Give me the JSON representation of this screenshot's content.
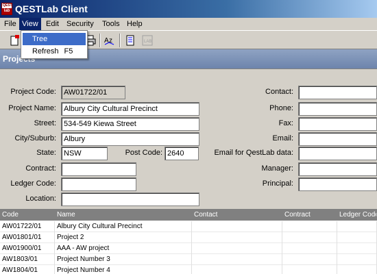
{
  "app": {
    "title": "QESTLab Client",
    "logo_top": "QEST",
    "logo_bottom": "lab"
  },
  "menu": {
    "file": "File",
    "view": "View",
    "edit": "Edit",
    "security": "Security",
    "tools": "Tools",
    "help": "Help"
  },
  "view_menu": {
    "tree": "Tree",
    "refresh": "Refresh",
    "refresh_shortcut": "F5"
  },
  "toolbar": {
    "icons": [
      "new-icon",
      "print-icon",
      "spell-check-icon",
      "copy-list-icon",
      "qestlab-disabled-icon"
    ]
  },
  "section": {
    "title": "Projects"
  },
  "form": {
    "project_code": {
      "label": "Project Code:",
      "value": "AW01722/01"
    },
    "project_name": {
      "label": "Project Name:",
      "value": "Albury City Cultural Precinct"
    },
    "street": {
      "label": "Street:",
      "value": "534-549 Kiewa Street"
    },
    "city": {
      "label": "City/Suburb:",
      "value": "Albury"
    },
    "state": {
      "label": "State:",
      "value": "NSW"
    },
    "post_code": {
      "label": "Post Code:",
      "value": "2640"
    },
    "contract": {
      "label": "Contract:",
      "value": ""
    },
    "ledger_code": {
      "label": "Ledger Code:",
      "value": ""
    },
    "location": {
      "label": "Location:",
      "value": ""
    },
    "contact": {
      "label": "Contact:",
      "value": ""
    },
    "phone": {
      "label": "Phone:",
      "value": ""
    },
    "fax": {
      "label": "Fax:",
      "value": ""
    },
    "email": {
      "label": "Email:",
      "value": ""
    },
    "email_qestlab": {
      "label": "Email for QestLab data:",
      "value": ""
    },
    "manager": {
      "label": "Manager:",
      "value": ""
    },
    "principal": {
      "label": "Principal:",
      "value": ""
    }
  },
  "grid": {
    "columns": [
      "Code",
      "Name",
      "Contact",
      "Contract",
      "Ledger Code"
    ],
    "rows": [
      [
        "AW01722/01",
        "Albury City Cultural Precinct",
        "",
        "",
        ""
      ],
      [
        "AW01801/01",
        "Project 2",
        "",
        "",
        ""
      ],
      [
        "AW01900/01",
        "AAA - AW project",
        "",
        "",
        ""
      ],
      [
        "AW1803/01",
        "Project Number 3",
        "",
        "",
        ""
      ],
      [
        "AW1804/01",
        "Project Number 4",
        "",
        "",
        ""
      ]
    ]
  },
  "colors": {
    "title_start": "#0a246a",
    "title_end": "#a6caf0",
    "menu_highlight": "#3d6cc8",
    "section_header": "#7b90b6"
  }
}
